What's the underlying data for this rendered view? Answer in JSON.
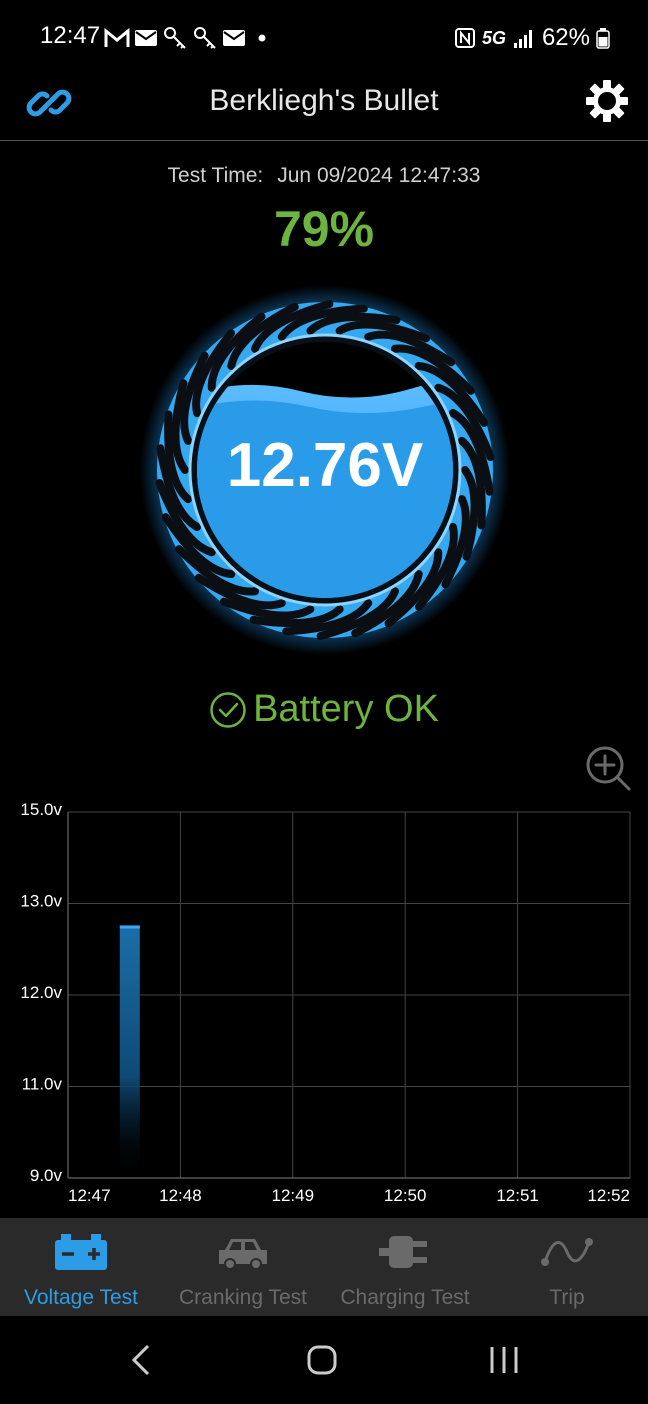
{
  "status_bar": {
    "time": "12:47",
    "left_icons": [
      "gmail-icon",
      "mail-icon",
      "key-icon",
      "key-icon",
      "mail-icon",
      "dot-icon"
    ],
    "network": "5G",
    "battery_percent": "62%"
  },
  "app_bar": {
    "title": "Berkliegh's Bullet",
    "left_icon": "link-icon",
    "right_icon": "gear-icon"
  },
  "test": {
    "time_label": "Test Time:",
    "time_value": "Jun 09/2024 12:47:33",
    "percent": "79%",
    "voltage": "12.76V",
    "status": "Battery OK"
  },
  "colors": {
    "accent_blue": "#2d9ce6",
    "ok_green": "#6db33f",
    "nav_bg": "#2a2a2a"
  },
  "chart_data": {
    "type": "bar",
    "y_tick_labels": [
      "15.0v",
      "13.0v",
      "12.0v",
      "11.0v",
      "9.0v"
    ],
    "x_tick_labels": [
      "12:47",
      "12:48",
      "12:49",
      "12:50",
      "12:51",
      "12:52"
    ],
    "bars": [
      {
        "x": "12:47:33",
        "value": 12.76
      }
    ],
    "grid": true
  },
  "bottom_nav": {
    "items": [
      {
        "label": "Voltage Test",
        "icon": "battery-icon",
        "active": true
      },
      {
        "label": "Cranking Test",
        "icon": "car-icon",
        "active": false
      },
      {
        "label": "Charging Test",
        "icon": "plug-icon",
        "active": false
      },
      {
        "label": "Trip",
        "icon": "route-icon",
        "active": false
      }
    ]
  }
}
